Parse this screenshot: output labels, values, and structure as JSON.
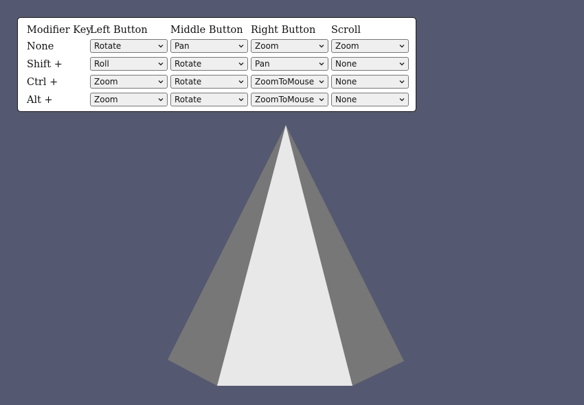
{
  "colors": {
    "background": "#545870",
    "panel": "#ffffff",
    "pyramid_front": "#e8e8e8",
    "pyramid_side": "#777777"
  },
  "headers": {
    "modifier": "Modifier Key",
    "left": "Left Button",
    "middle": "Middle Button",
    "right": "Right Button",
    "scroll": "Scroll"
  },
  "rows": [
    {
      "label": "None",
      "left": "Rotate",
      "middle": "Pan",
      "right": "Zoom",
      "scroll": "Zoom"
    },
    {
      "label": "Shift +",
      "left": "Roll",
      "middle": "Rotate",
      "right": "Pan",
      "scroll": "None"
    },
    {
      "label": "Ctrl +",
      "left": "Zoom",
      "middle": "Rotate",
      "right": "ZoomToMouse",
      "scroll": "None"
    },
    {
      "label": "Alt +",
      "left": "Zoom",
      "middle": "Rotate",
      "right": "ZoomToMouse",
      "scroll": "None"
    }
  ]
}
